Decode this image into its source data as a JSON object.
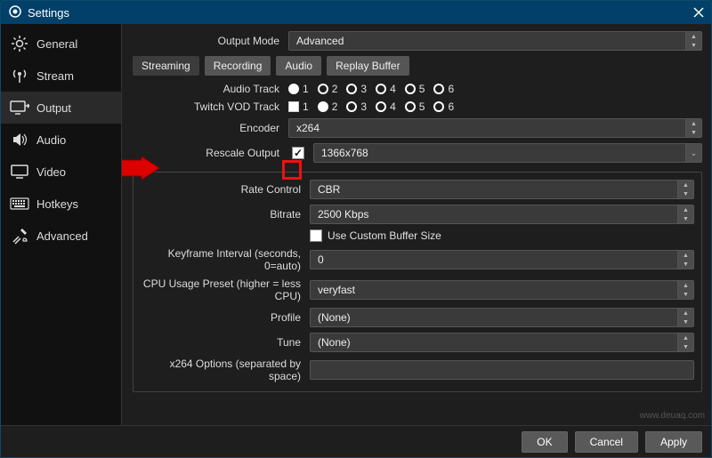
{
  "title": "Settings",
  "sidebar": {
    "items": [
      {
        "label": "General"
      },
      {
        "label": "Stream"
      },
      {
        "label": "Output"
      },
      {
        "label": "Audio"
      },
      {
        "label": "Video"
      },
      {
        "label": "Hotkeys"
      },
      {
        "label": "Advanced"
      }
    ]
  },
  "output_mode": {
    "label": "Output Mode",
    "value": "Advanced"
  },
  "tabs": {
    "items": [
      {
        "label": "Streaming"
      },
      {
        "label": "Recording"
      },
      {
        "label": "Audio"
      },
      {
        "label": "Replay Buffer"
      }
    ]
  },
  "audio_track": {
    "label": "Audio Track",
    "options": [
      "1",
      "2",
      "3",
      "4",
      "5",
      "6"
    ],
    "selected": "1"
  },
  "twitch_vod_track": {
    "label": "Twitch VOD Track",
    "options": [
      "1",
      "2",
      "3",
      "4",
      "5",
      "6"
    ],
    "selected": "2"
  },
  "encoder": {
    "label": "Encoder",
    "value": "x264"
  },
  "rescale": {
    "label": "Rescale Output",
    "checked": true,
    "value": "1366x768"
  },
  "rate_control": {
    "label": "Rate Control",
    "value": "CBR"
  },
  "bitrate": {
    "label": "Bitrate",
    "value": "2500 Kbps"
  },
  "custom_buffer": {
    "label": "Use Custom Buffer Size",
    "checked": false
  },
  "keyframe": {
    "label": "Keyframe Interval (seconds, 0=auto)",
    "value": "0"
  },
  "cpu_preset": {
    "label": "CPU Usage Preset (higher = less CPU)",
    "value": "veryfast"
  },
  "profile": {
    "label": "Profile",
    "value": "(None)"
  },
  "tune": {
    "label": "Tune",
    "value": "(None)"
  },
  "x264_options": {
    "label": "x264 Options (separated by space)",
    "value": ""
  },
  "footer": {
    "ok": "OK",
    "cancel": "Cancel",
    "apply": "Apply"
  },
  "watermark": "www.deuaq.com"
}
